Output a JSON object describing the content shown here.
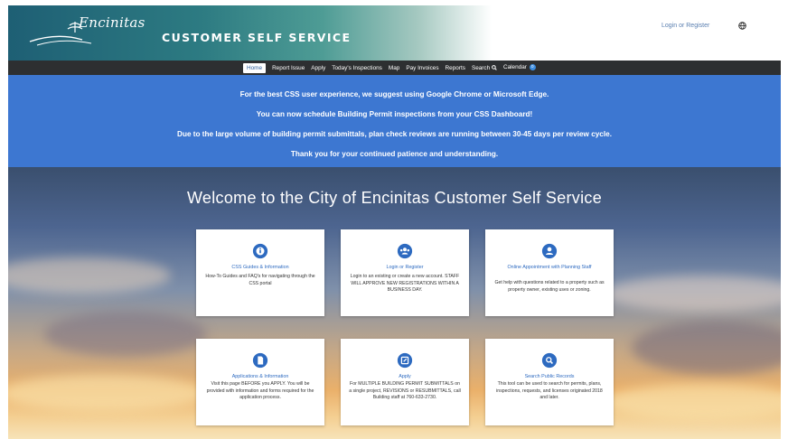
{
  "header": {
    "logo_text": "Encinitas",
    "app_title": "CUSTOMER SELF SERVICE",
    "login_label": "Login or Register"
  },
  "nav": {
    "items": [
      "Home",
      "Report Issue",
      "Apply",
      "Today's Inspections",
      "Map",
      "Pay Invoices",
      "Reports",
      "Search",
      "Calendar"
    ],
    "active": "Home",
    "calendar_badge": "0"
  },
  "announcements": [
    "For the best CSS user experience, we suggest using Google Chrome or Microsoft Edge.",
    "You can now schedule Building Permit inspections from your CSS Dashboard!",
    "Due to the large volume of building permit submittals, plan check reviews are running between 30-45 days per review cycle.",
    "Thank you for your continued patience and understanding."
  ],
  "hero_title": "Welcome to the City of Encinitas Customer Self Service",
  "cards": [
    {
      "icon": "info-icon",
      "title": "CSS Guides & Information",
      "desc": "How-To Guides and FAQ's for navigating through the CSS portal"
    },
    {
      "icon": "users-icon",
      "title": "Login or Register",
      "desc": "Login to an existing or create a new account. STAFF WILL APPROVE NEW REGISTRATIONS WITHIN A BUSINESS DAY."
    },
    {
      "icon": "user-icon",
      "title": "Online Appointment with Planning Staff",
      "desc": "Get help with questions related to a property such as property owner, existing uses or zoning."
    },
    {
      "icon": "document-icon",
      "title": "Applications & Information",
      "desc": "Visit this page BEFORE you APPLY. You will be provided with information and forms required for the application process."
    },
    {
      "icon": "edit-icon",
      "title": "Apply",
      "desc": "For MULTIPLE BUILDING PERMIT SUBMITTALS on a single project, REVISIONS or RESUBMITTALS, call Building staff at 760-633-2730."
    },
    {
      "icon": "search-icon",
      "title": "Search Public Records",
      "desc": "This tool can be used to search for permits, plans, inspections, requests, and licenses originated 2018 and later."
    }
  ],
  "colors": {
    "nav_bg": "#2d2f31",
    "announce_bg": "#3d77d1",
    "accent": "#2d6ac0",
    "header_teal": "#1e5f74"
  }
}
